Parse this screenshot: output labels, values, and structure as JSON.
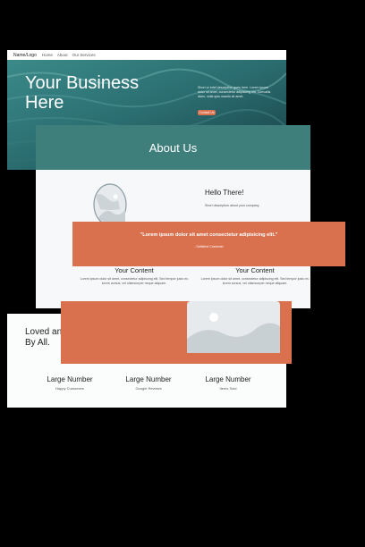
{
  "hero": {
    "nav": {
      "logo": "Name/Logo",
      "links": [
        "Home",
        "About",
        "Our Services"
      ]
    },
    "title_line1": "Your Business",
    "title_line2": "Here",
    "description": "Short or brief description goes here. Lorem ipsum dolor sit amet, consectetur adipiscing elit. Convallis diam, nulla quis mauris sit amet.",
    "button_label": "Contact Us"
  },
  "about": {
    "title": "About Us",
    "hello_title": "Hello There!",
    "hello_desc": "Short description about your company",
    "columns": [
      {
        "title": "Your Content",
        "text": "Lorem ipsum dolor sit amet, consectetur adipiscing elit. Sed tempor justo eu lorem cursus, vel ullamcorper neque aliquam."
      },
      {
        "title": "Your Content",
        "text": "Lorem ipsum dolor sit amet, consectetur adipiscing elit. Sed tempor justo eu lorem cursus, vel ullamcorper neque aliquam."
      }
    ]
  },
  "testimonial": {
    "quote": "\"Lorem ipsum dolor sit amet consectetur adipisicing elit.\"",
    "author": "- Satisfied Customer"
  },
  "stats": {
    "heading_line1": "Loved and",
    "heading_line2": "By All.",
    "items": [
      {
        "number": "Large Number",
        "label": "Happy Customers"
      },
      {
        "number": "Large Number",
        "label": "Google Reviews"
      },
      {
        "number": "Large Number",
        "label": "Items Sold"
      }
    ]
  },
  "colors": {
    "teal": "#3e7f7b",
    "orange": "#d9714f",
    "background": "#000000"
  },
  "icons": {
    "about_image": "placeholder-portrait-icon",
    "panel_image": "placeholder-landscape-icon"
  }
}
